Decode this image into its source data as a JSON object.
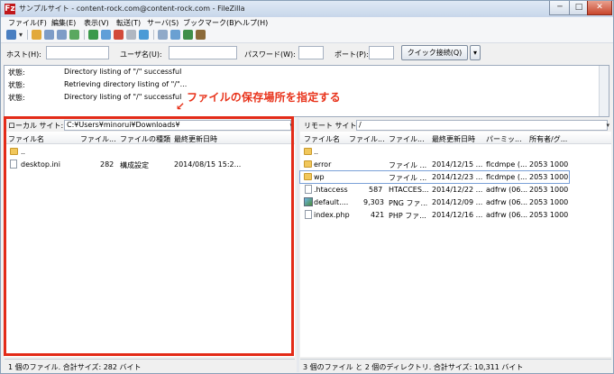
{
  "window": {
    "title": "サンプルサイト - content-rock.com@content-rock.com - FileZilla",
    "app_icon": "Fz",
    "controls": {
      "minimize": "─",
      "maximize": "□",
      "close": "✕"
    }
  },
  "menu": [
    "ファイル(F)",
    "編集(E)",
    "表示(V)",
    "転送(T)",
    "サーバ(S)",
    "ブックマーク(B)",
    "ヘルプ(H)"
  ],
  "quickconnect": {
    "host_label": "ホスト(H):",
    "user_label": "ユーザ名(U):",
    "password_label": "パスワード(W):",
    "port_label": "ポート(P):",
    "connect_button": "クイック接続(Q)",
    "dropdown": "▾"
  },
  "log": [
    {
      "status": "状態:",
      "message": "Directory listing of \"/\" successful"
    },
    {
      "status": "状態:",
      "message": "Retrieving directory listing of \"/\"..."
    },
    {
      "status": "状態:",
      "message": "Directory listing of \"/\" successful"
    }
  ],
  "annotation": {
    "text": "ファイルの保存場所を指定する",
    "arrow": "↙",
    "color": "#e32b18"
  },
  "local": {
    "site_label": "ローカル サイト:",
    "path": "C:¥Users¥minorui¥Downloads¥",
    "columns": [
      "ファイル名",
      "ファイル...",
      "ファイルの種類",
      "最終更新日時"
    ],
    "rows": [
      {
        "icon": "folder-icon",
        "name": "..",
        "size": "",
        "type": "",
        "modified": ""
      },
      {
        "icon": "file-icon",
        "name": "desktop.ini",
        "size": "282",
        "type": "構成設定",
        "modified": "2014/08/15 15:2..."
      }
    ],
    "status": "1 個のファイル. 合計サイズ: 282 バイト"
  },
  "remote": {
    "site_label": "リモート サイト:",
    "path": "/",
    "columns": [
      "ファイル名",
      "ファイル...",
      "ファイル...",
      "最終更新日時",
      "パーミッ...",
      "所有者/グ..."
    ],
    "rows": [
      {
        "icon": "folder-icon",
        "name": "..",
        "size": "",
        "type": "",
        "modified": "",
        "perm": "",
        "owner": ""
      },
      {
        "icon": "folder-icon",
        "name": "error",
        "size": "",
        "type": "ファイル ...",
        "modified": "2014/12/15 ...",
        "perm": "flcdmpe (...",
        "owner": "2053 1000"
      },
      {
        "icon": "folder-icon",
        "name": "wp",
        "size": "",
        "type": "ファイル ...",
        "modified": "2014/12/23 ...",
        "perm": "flcdmpe (...",
        "owner": "2053 1000"
      },
      {
        "icon": "file-icon",
        "name": ".htaccess",
        "size": "587",
        "type": "HTACCES...",
        "modified": "2014/12/22 ...",
        "perm": "adfrw (06...",
        "owner": "2053 1000"
      },
      {
        "icon": "image-icon",
        "name": "default....",
        "size": "9,303",
        "type": "PNG ファ...",
        "modified": "2014/12/09 ...",
        "perm": "adfrw (06...",
        "owner": "2053 1000"
      },
      {
        "icon": "file-icon",
        "name": "index.php",
        "size": "421",
        "type": "PHP ファ...",
        "modified": "2014/12/16 ...",
        "perm": "adfrw (06...",
        "owner": "2053 1000"
      }
    ],
    "status": "3 個のファイル と 2 個のディレクトリ. 合計サイズ: 10,311 バイト"
  }
}
